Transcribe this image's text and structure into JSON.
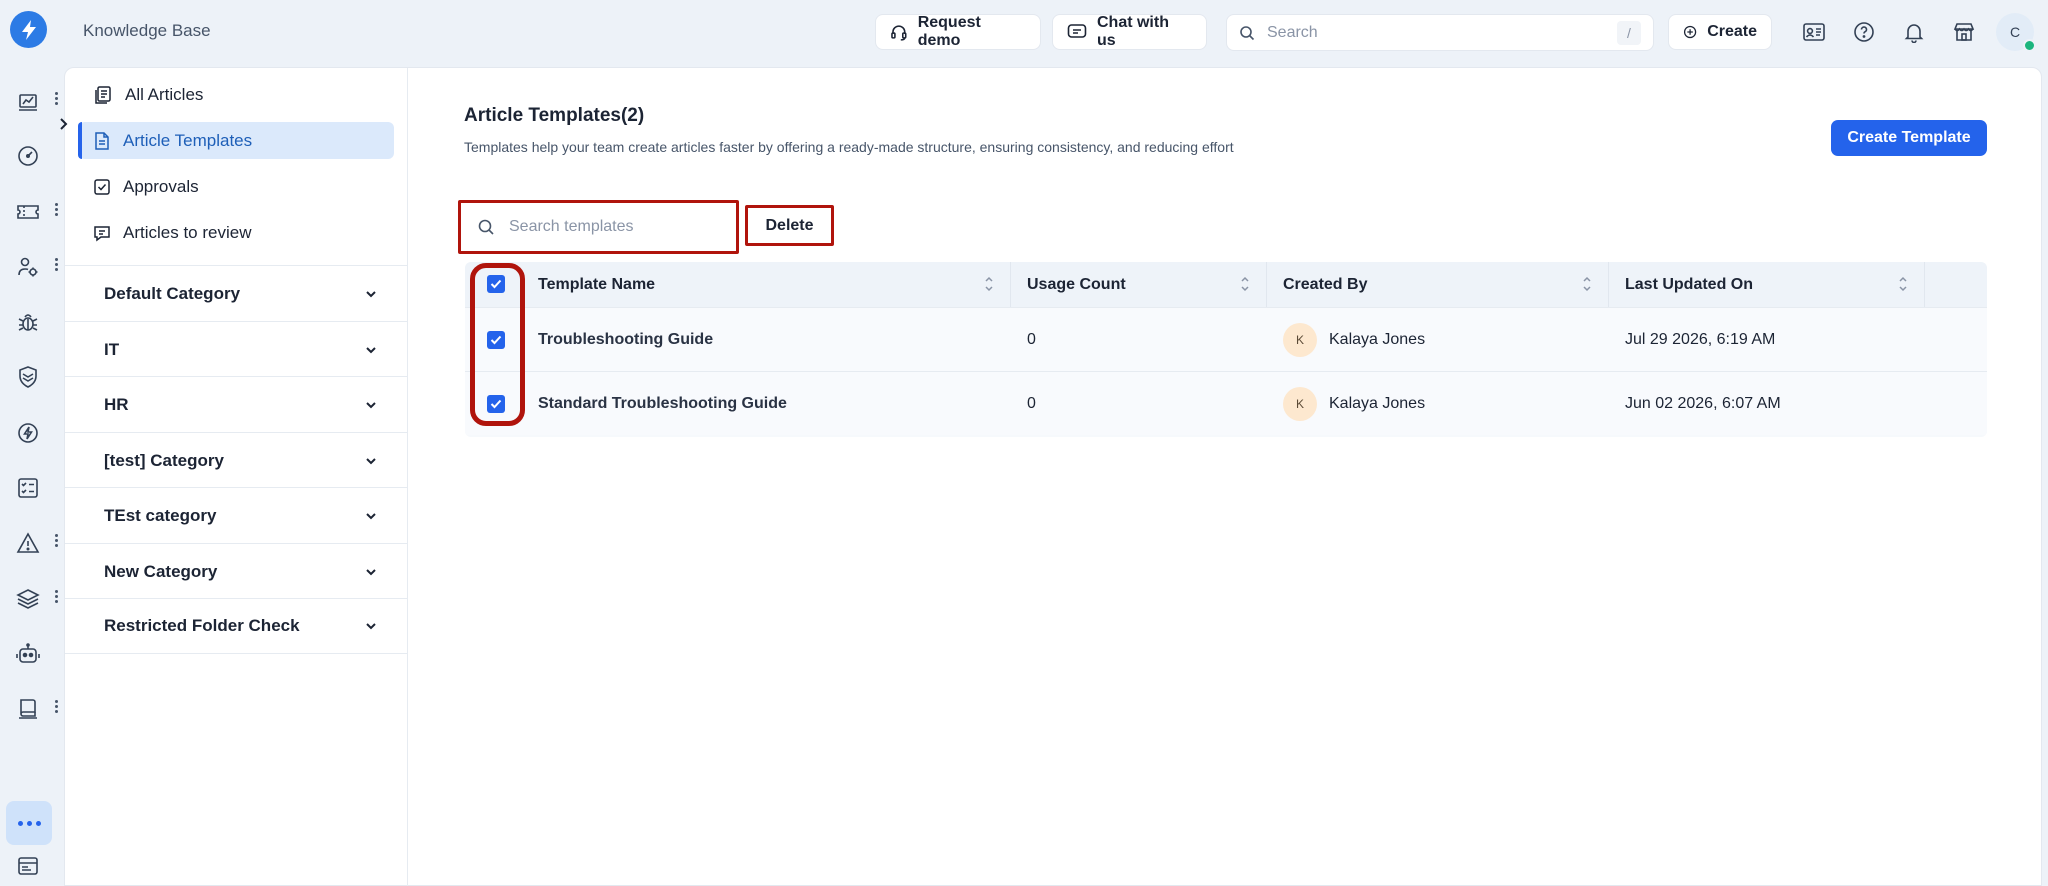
{
  "header": {
    "app_title": "Knowledge Base",
    "request_demo": "Request demo",
    "chat_with_us": "Chat with us",
    "search_placeholder": "Search",
    "search_shortcut": "/",
    "create_label": "Create",
    "user_initial": "C"
  },
  "sidebar": {
    "nav": [
      {
        "label": "All Articles",
        "icon": "stacked-docs-icon"
      },
      {
        "label": "Article Templates",
        "icon": "document-icon",
        "active": true
      },
      {
        "label": "Approvals",
        "icon": "checkbox-icon"
      },
      {
        "label": "Articles to review",
        "icon": "review-comment-icon"
      }
    ],
    "categories": [
      "Default Category",
      "IT",
      "HR",
      "[test] Category",
      "TEst category",
      "New Category",
      "Restricted Folder Check"
    ]
  },
  "main": {
    "title": "Article Templates(2)",
    "description": "Templates help your team create articles faster by offering a ready-made structure, ensuring consistency, and reducing effort",
    "create_template": "Create Template",
    "search_placeholder": "Search templates",
    "delete_label": "Delete"
  },
  "table": {
    "columns": [
      "Template Name",
      "Usage Count",
      "Created By",
      "Last Updated On"
    ],
    "rows": [
      {
        "name": "Troubleshooting Guide",
        "usage": "0",
        "creator_initial": "K",
        "creator": "Kalaya Jones",
        "updated": "Jul 29 2026, 6:19 AM",
        "checked": true
      },
      {
        "name": "Standard Troubleshooting Guide",
        "usage": "0",
        "creator_initial": "K",
        "creator": "Kalaya Jones",
        "updated": "Jun 02 2026, 6:07 AM",
        "checked": true
      }
    ]
  },
  "colors": {
    "accent": "#2463eb",
    "highlight_red": "#b0140c",
    "active_nav_bg": "#dbe9fb"
  }
}
